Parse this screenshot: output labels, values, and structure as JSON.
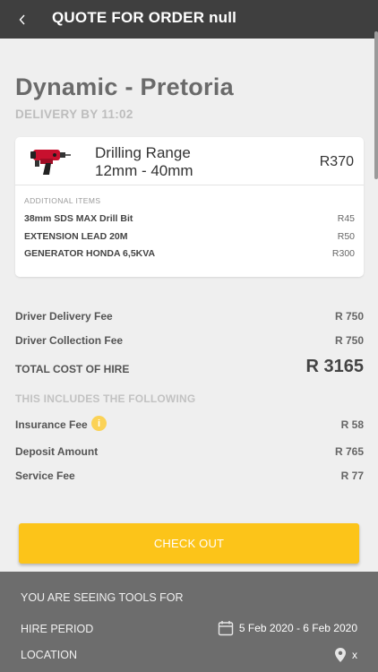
{
  "header": {
    "back_icon": "chevron-left-icon",
    "title": "QUOTE FOR ORDER null"
  },
  "store": {
    "name": "Dynamic - Pretoria",
    "delivery": "DELIVERY BY 11:02"
  },
  "tool": {
    "name_line1": "Drilling Range",
    "name_line2": "12mm - 40mm",
    "price": "R370",
    "image_icon": "rotary-hammer-drill-icon"
  },
  "additional": {
    "heading": "ADDITIONAL ITEMS",
    "items": [
      {
        "name": "38mm SDS MAX Drill Bit",
        "price": "R45"
      },
      {
        "name": "EXTENSION LEAD 20M",
        "price": "R50"
      },
      {
        "name": "GENERATOR HONDA 6,5KVA",
        "price": "R300"
      }
    ]
  },
  "fees": {
    "delivery": {
      "label": "Driver Delivery Fee",
      "value": "R 750"
    },
    "collection": {
      "label": "Driver Collection Fee",
      "value": "R 750"
    },
    "total": {
      "label": "TOTAL COST OF HIRE",
      "value": "R 3165"
    },
    "includes_heading": "THIS INCLUDES THE FOLLOWING",
    "insurance": {
      "label": "Insurance Fee",
      "value": "R 58",
      "info_icon": "info-icon"
    },
    "deposit": {
      "label": "Deposit Amount",
      "value": "R 765"
    },
    "service": {
      "label": "Service Fee",
      "value": "R 77"
    }
  },
  "checkout": {
    "label": "CHECK OUT"
  },
  "bottom": {
    "heading": "YOU ARE SEEING TOOLS FOR",
    "hire_period_label": "HIRE PERIOD",
    "hire_period_value": "5 Feb 2020 - 6 Feb 2020",
    "location_label": "LOCATION",
    "location_value": "x"
  },
  "colors": {
    "appbar": "#3f3f3f",
    "accent": "#fcc419",
    "background": "#efefef",
    "bottom_panel": "#6d6d6d"
  }
}
